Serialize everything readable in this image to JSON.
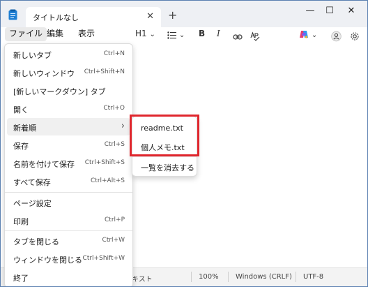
{
  "colors": {
    "highlight": "#e0262d",
    "window_border": "#5a7fb0",
    "copilot_gradient": [
      "#e43e6f",
      "#7a5cf0",
      "#f4b431",
      "#2e9bf0"
    ]
  },
  "titlebar": {
    "tab_title": "タイトルなし",
    "tab_close": "✕",
    "new_tab": "+",
    "minimize": "—",
    "maximize": "☐",
    "close": "✕"
  },
  "menubar": {
    "file": "ファイル",
    "edit": "編集",
    "view": "表示",
    "heading": "H1",
    "chevron": "⌄",
    "bold": "B",
    "italic": "I"
  },
  "file_menu": [
    {
      "label": "新しいタブ",
      "shortcut": "Ctrl+N"
    },
    {
      "label": "新しいウィンドウ",
      "shortcut": "Ctrl+Shift+N"
    },
    {
      "label": "[新しいマークダウン] タブ",
      "shortcut": ""
    },
    {
      "label": "開く",
      "shortcut": "Ctrl+O"
    },
    {
      "label": "新着順",
      "shortcut": ""
    },
    {
      "label": "保存",
      "shortcut": "Ctrl+S"
    },
    {
      "label": "名前を付けて保存",
      "shortcut": "Ctrl+Shift+S"
    },
    {
      "label": "すべて保存",
      "shortcut": "Ctrl+Alt+S"
    },
    {
      "label": "ページ設定",
      "shortcut": ""
    },
    {
      "label": "印刷",
      "shortcut": "Ctrl+P"
    },
    {
      "label": "タブを閉じる",
      "shortcut": "Ctrl+W"
    },
    {
      "label": "ウィンドウを閉じる",
      "shortcut": "Ctrl+Shift+W"
    },
    {
      "label": "終了",
      "shortcut": ""
    }
  ],
  "submenu_arrow": "›",
  "recent_submenu": {
    "items": [
      "readme.txt",
      "個人メモ.txt"
    ],
    "clear": "一覧を消去する"
  },
  "statusbar": {
    "type": "キスト",
    "zoom": "100%",
    "line_ending": "Windows (CRLF)",
    "encoding": "UTF-8"
  }
}
